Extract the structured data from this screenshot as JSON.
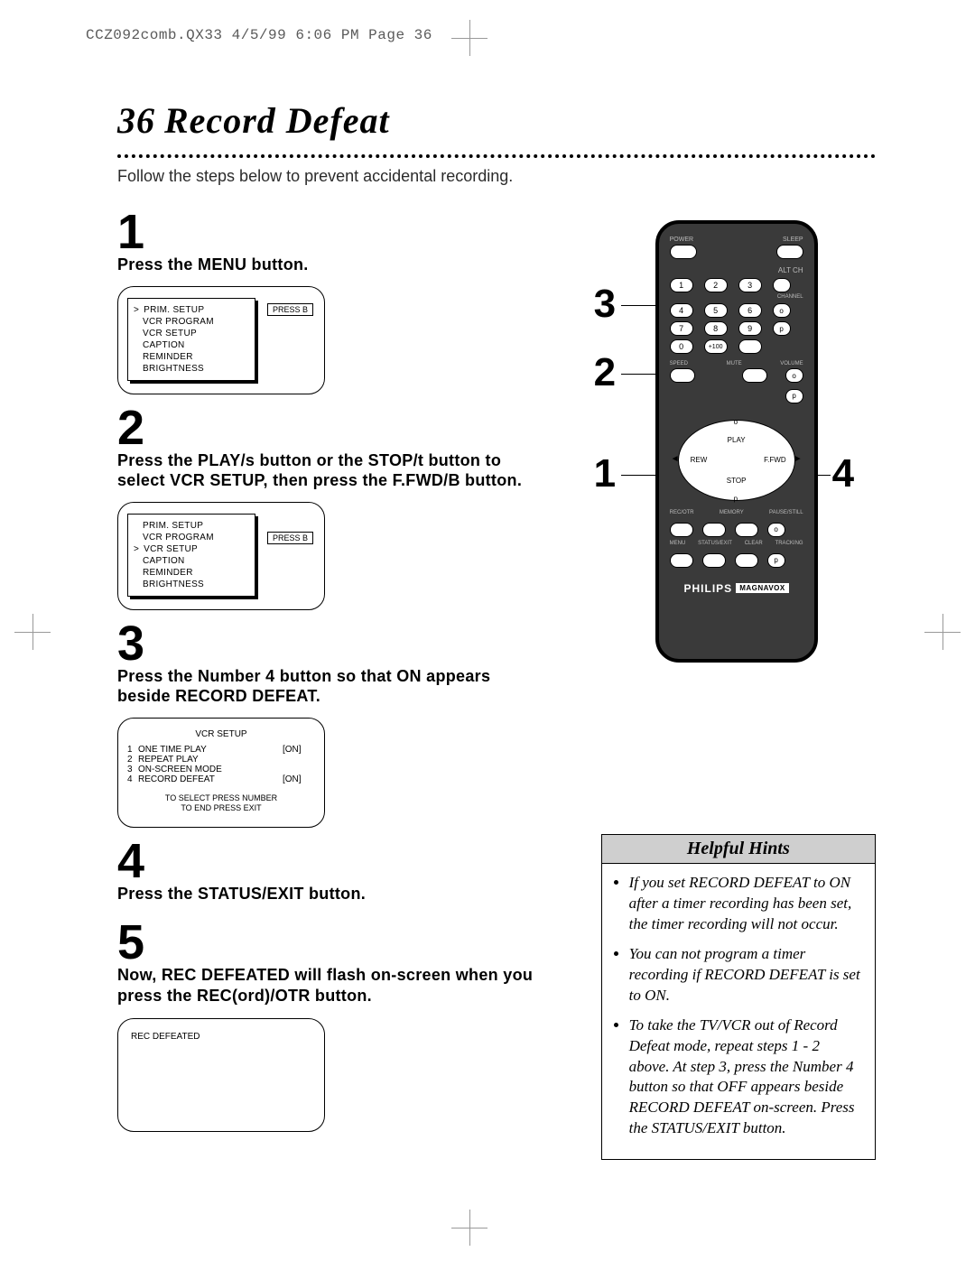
{
  "meta": {
    "header": "CCZ092comb.QX33  4/5/99 6:06 PM  Page 36"
  },
  "page": {
    "number": "36",
    "title": "Record Defeat",
    "intro": "Follow the steps below to prevent accidental recording."
  },
  "steps": {
    "s1": {
      "num": "1",
      "text": "Press the MENU button.",
      "menu": {
        "cursor_index": 0,
        "press_label": "PRESS B",
        "items": [
          "PRIM. SETUP",
          "VCR PROGRAM",
          "VCR SETUP",
          "CAPTION",
          "REMINDER",
          "BRIGHTNESS"
        ]
      }
    },
    "s2": {
      "num": "2",
      "text": "Press the PLAY/s  button or the STOP/t  button to select VCR SETUP, then press the F.FWD/B  button.",
      "menu": {
        "cursor_index": 2,
        "press_label": "PRESS B",
        "items": [
          "PRIM. SETUP",
          "VCR PROGRAM",
          "VCR SETUP",
          "CAPTION",
          "REMINDER",
          "BRIGHTNESS"
        ]
      }
    },
    "s3": {
      "num": "3",
      "text": "Press the Number 4 button so that ON appears beside RECORD DEFEAT.",
      "setup": {
        "title": "VCR SETUP",
        "rows": [
          {
            "n": "1",
            "label": "ONE TIME PLAY",
            "val": "[ON]"
          },
          {
            "n": "2",
            "label": "REPEAT PLAY",
            "val": ""
          },
          {
            "n": "3",
            "label": "ON-SCREEN MODE",
            "val": ""
          },
          {
            "n": "4",
            "label": "RECORD DEFEAT",
            "val": "[ON]"
          }
        ],
        "footer1": "TO SELECT PRESS NUMBER",
        "footer2": "TO END PRESS EXIT"
      }
    },
    "s4": {
      "num": "4",
      "text": "Press the STATUS/EXIT button."
    },
    "s5": {
      "num": "5",
      "text": "Now, REC DEFEATED will flash on-screen when you press the REC(ord)/OTR button.",
      "screen_text": "REC DEFEATED"
    }
  },
  "remote": {
    "callouts": {
      "c1": "1",
      "c2": "2",
      "c3": "3",
      "c4": "4"
    },
    "labels": {
      "power": "POWER",
      "sleep": "SLEEP",
      "altch": "ALT CH",
      "channel": "CHANNEL",
      "speed": "SPEED",
      "mute": "MUTE",
      "volume": "VOLUME",
      "play": "PLAY",
      "stop": "STOP",
      "rew": "REW",
      "ffwd": "F.FWD",
      "recotr": "REC/OTR",
      "memory": "MEMORY",
      "pausestill": "PAUSE/STILL",
      "menu": "MENU",
      "statusexit": "STATUS/EXIT",
      "clear": "CLEAR",
      "tracking": "TRACKING",
      "brand_p": "PHILIPS",
      "brand_m": "MAGNAVOX",
      "plus100": "+100"
    },
    "nums": [
      "1",
      "2",
      "3",
      "4",
      "5",
      "6",
      "7",
      "8",
      "9",
      "0"
    ],
    "side_syms": {
      "up": "o",
      "down": "p"
    }
  },
  "hints": {
    "title": "Helpful Hints",
    "items": [
      "If you set RECORD DEFEAT to ON after a timer recording has been set, the timer recording will not occur.",
      "You can not program a timer recording if RECORD DEFEAT is set to ON.",
      "To take the TV/VCR out of Record Defeat mode, repeat steps 1 - 2 above.  At step 3, press the Number 4 button so that OFF appears beside RECORD DEFEAT on-screen. Press the STATUS/EXIT button."
    ]
  }
}
